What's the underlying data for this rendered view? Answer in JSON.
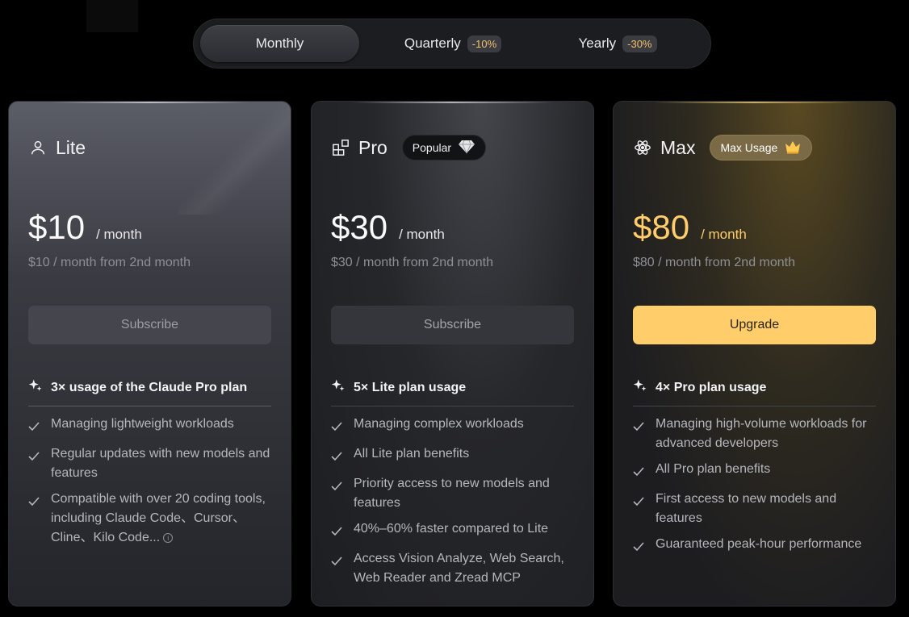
{
  "billing": {
    "options": [
      {
        "label": "Monthly",
        "badge": ""
      },
      {
        "label": "Quarterly",
        "badge": "-10%"
      },
      {
        "label": "Yearly",
        "badge": "-30%"
      }
    ],
    "selected": "Monthly"
  },
  "plans": [
    {
      "name": "Lite",
      "icon": "user-icon",
      "tag": "",
      "price": "$10",
      "per": "/ month",
      "note": "$10 / month from 2nd month",
      "cta": "Subscribe",
      "feature_head": "3× usage of the Claude Pro plan",
      "features": [
        "Managing lightweight workloads",
        "Regular updates with new models and features",
        "Compatible with over 20 coding tools, including Claude Code、Cursor、Cline、Kilo Code..."
      ]
    },
    {
      "name": "Pro",
      "icon": "blocks-icon",
      "tag": "Popular",
      "tag_icon": "diamond-icon",
      "price": "$30",
      "per": "/ month",
      "note": "$30 / month from 2nd month",
      "cta": "Subscribe",
      "feature_head": "5× Lite plan usage",
      "features": [
        "Managing complex workloads",
        "All Lite plan benefits",
        "Priority access to new models and features",
        "40%–60% faster compared to Lite",
        "Access Vision Analyze, Web Search, Web Reader and Zread MCP"
      ]
    },
    {
      "name": "Max",
      "icon": "atom-icon",
      "tag": "Max Usage",
      "tag_icon": "crown-icon",
      "price": "$80",
      "per": "/ month",
      "note": "$80 / month from 2nd month",
      "cta": "Upgrade",
      "feature_head": "4× Pro plan usage",
      "features": [
        "Managing high-volume workloads for advanced developers",
        "All Pro plan benefits",
        "First access to new models and features",
        "Guaranteed peak-hour performance"
      ]
    }
  ],
  "colors": {
    "accent_gold": "#ffcd6a",
    "badge_text": "#f3c06a",
    "background": "#000000"
  }
}
